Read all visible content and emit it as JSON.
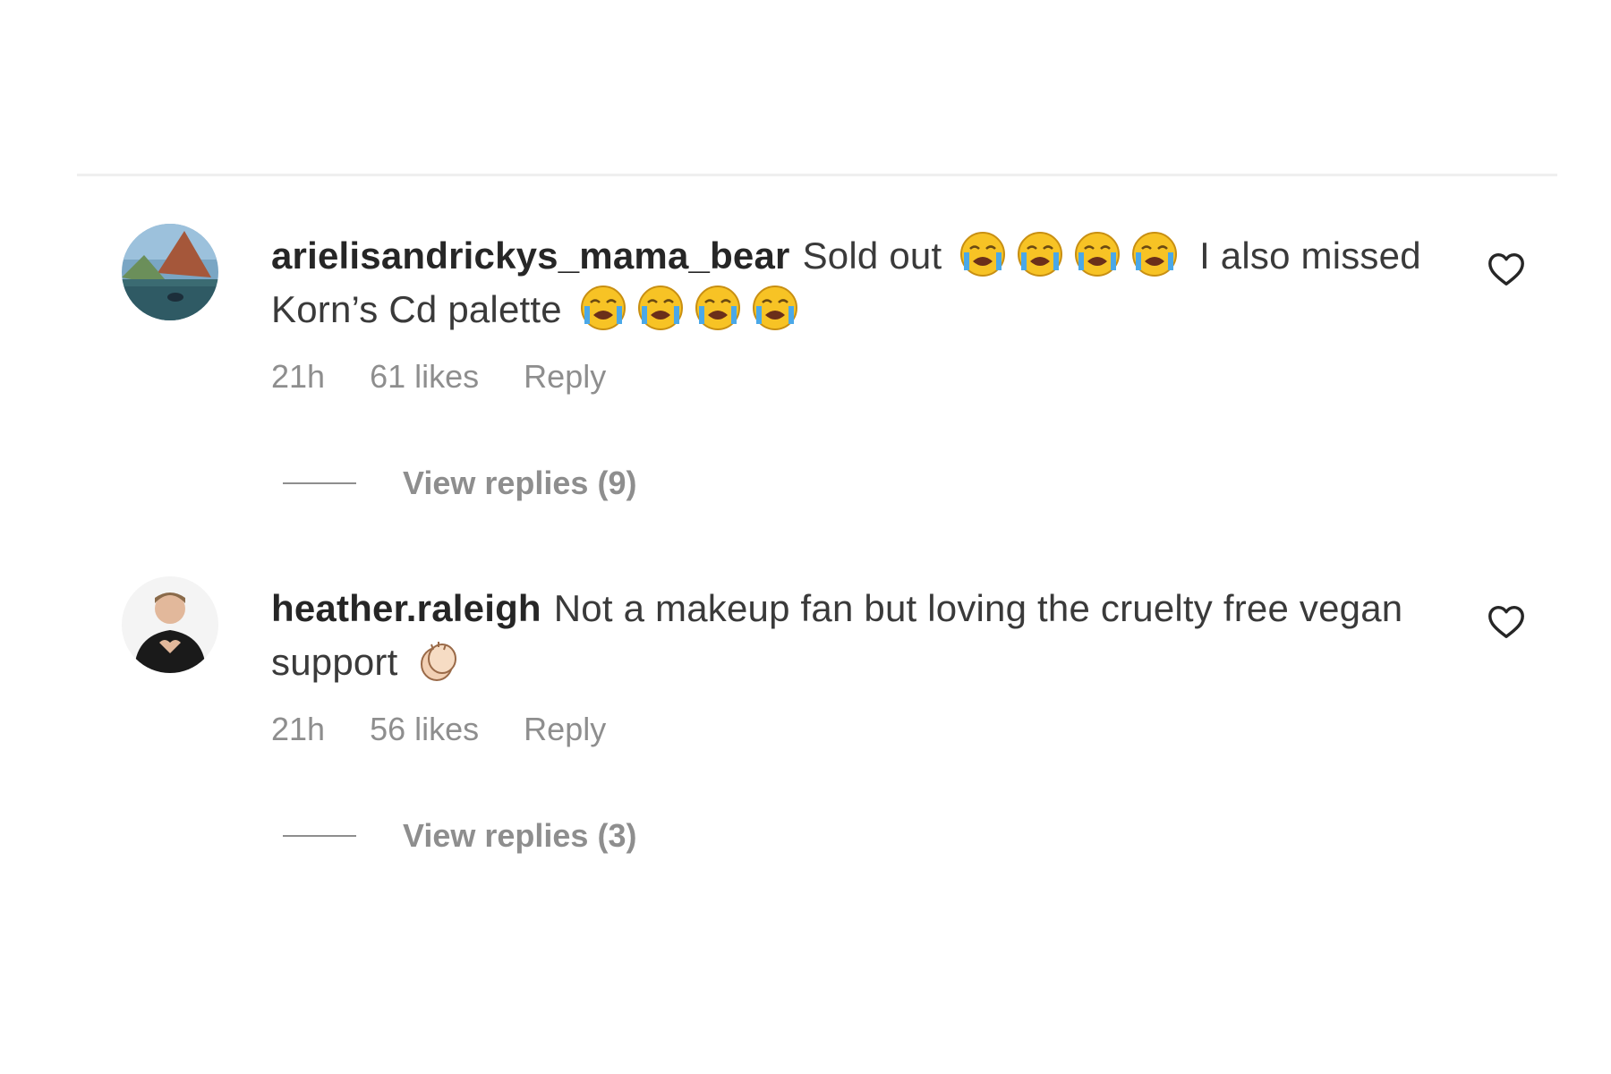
{
  "comments": [
    {
      "username": "arielisandrickys_mama_bear",
      "text_part1": "Sold out",
      "emoji_run1": [
        "crying-face",
        "crying-face",
        "crying-face",
        "crying-face"
      ],
      "text_part2": "I also missed Korn’s Cd palette",
      "emoji_run2": [
        "crying-face",
        "crying-face",
        "crying-face",
        "crying-face"
      ],
      "time": "21h",
      "likes": "61 likes",
      "reply_label": "Reply",
      "view_replies": "View replies (9)"
    },
    {
      "username": "heather.raleigh",
      "text_part1": "Not a makeup fan but loving the cruelty free vegan support",
      "emoji_run1": [
        "clapping-hands"
      ],
      "time": "21h",
      "likes": "56 likes",
      "reply_label": "Reply",
      "view_replies": "View replies (3)"
    }
  ],
  "icons": {
    "like": "heart-outline-icon",
    "avatar1": "landscape-avatar",
    "avatar2": "person-avatar"
  },
  "colors": {
    "username": "#262626",
    "text": "#3a3a3a",
    "meta": "#8e8e8e",
    "divider": "#efefef"
  }
}
